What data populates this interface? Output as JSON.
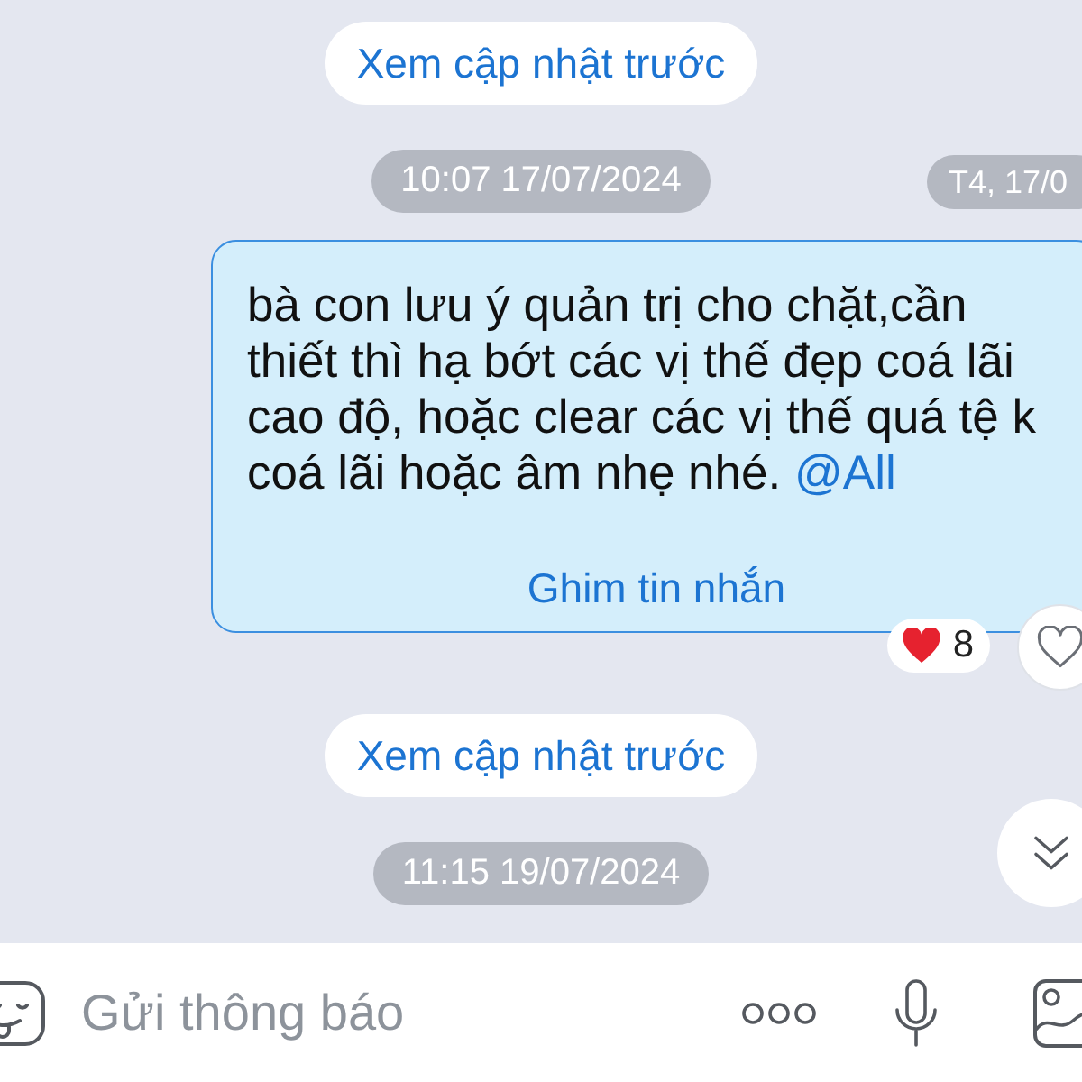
{
  "feed": [
    {
      "kind": "load_more",
      "label": "Xem cập nhật trước"
    },
    {
      "kind": "timestamp",
      "label": "10:07 17/07/2024"
    },
    {
      "kind": "message",
      "text": "bà con lưu ý quản trị cho chặt,cần thiết thì hạ bớt các vị thế đẹp coá lãi cao độ, hoặc clear các vị thế quá tệ k coá lãi hoặc âm nhẹ nhé.",
      "mention": "@All",
      "pin_label": "Ghim tin nhắn",
      "reaction_count": "8"
    },
    {
      "kind": "load_more",
      "label": "Xem cập nhật trước"
    },
    {
      "kind": "timestamp",
      "label": "11:15 19/07/2024"
    }
  ],
  "date_chip": {
    "label": "T4, 17/0"
  },
  "composer": {
    "placeholder": "Gửi thông báo"
  }
}
